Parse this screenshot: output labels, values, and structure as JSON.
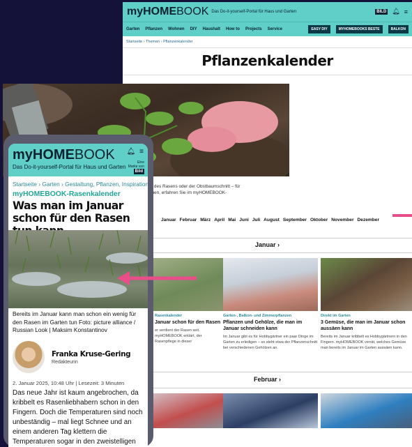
{
  "desktop": {
    "logo_bold": "myHOME",
    "logo_light": "BOOK",
    "tagline": "Das Do-it-yourself-Portal für Haus und Garten",
    "nav": [
      "Garten",
      "Pflanzen",
      "Wohnen",
      "DIY",
      "Haushalt",
      "How to",
      "Projects",
      "Service"
    ],
    "nav_buttons": [
      "EASY DIY",
      "MYHOMEBOOKS BESTE",
      "BALKON"
    ],
    "breadcrumb": "Startseite › Themen › Pflanzenkalender",
    "title": "Pflanzenkalender",
    "intro_line1": "gibt es etwas im Garten zu tun! Sei es die Anzucht von Pflanzen, die Pflege des Rasens oder der Obstbaumschnitt – für",
    "intro_line2": "er wird es nicht langweilig. Welche To-dos in den jeweiligen Monaten anstehen, erfahren Sie im myHOMEBOOK-",
    "intro_line3": "nder!",
    "months": [
      "Januar",
      "Februar",
      "März",
      "April",
      "Mai",
      "Juni",
      "Juli",
      "August",
      "September",
      "Oktober",
      "November",
      "Dezember"
    ],
    "section_januar": "Januar ›",
    "section_februar": "Februar ›",
    "cards": [
      {
        "category": "Rasenkalender",
        "title": "Januar schon für den Rasen",
        "text": "er verdient der Rasen seit. myHOMEBOOK erklärt, der Rasenpflege in dieser"
      },
      {
        "category": "Garten-, Balkon- und Zimmerpflanzen",
        "title": "Pflanzen und Gehölze, die man im Januar schneiden kann",
        "text": "Im Januar gibt es für Hobbygärtner ein paar Dinge im Garten zu erledigen – so steht etwa der Pflanzenschnitt bei verschiedenen Gehölzen an."
      },
      {
        "category": "Direkt im Garten",
        "title": "3 Gemüse, die man im Januar schon aussäen kann",
        "text": "Bereits im Januar kribbelt es Hobbygärtnern in den Fingern. myHOMEBOOK verrät, welches Gemüse man bereits im Januar im Garten aussäen kann."
      }
    ]
  },
  "mobile": {
    "logo_bold": "myHOME",
    "logo_light": "BOOK",
    "tagline": "Das Do-it-yourself-Portal für Haus und Garten",
    "bild_line1": "Eine",
    "bild_line2": "Marke von",
    "bild": "Bild",
    "breadcrumb": "Startseite › Garten › Gestaltung, Pflanzen, Inspiration",
    "kicker": "myHOMEBOOK-Rasenkalender",
    "headline": "Was man im Januar schon für den Rasen tun kann",
    "caption": "Bereits im Januar kann man schon ein wenig für den Rasen im Garten tun Foto: picture alliance / Russian Look | Maksim Konstantinov",
    "author_name": "Franka Kruse-Gering",
    "author_role": "Redakteurin",
    "date": "2. Januar 2025, 10:48 Uhr | Lesezeit: 3 Minuten",
    "body": "Das neue Jahr ist kaum angebrochen, da kribbelt es Rasenliebhabern schon in den Fingern. Doch die Temperaturen sind noch unbeständig – mal liegt Schnee und an einem anderen Tag klettern die Temperaturen sogar in den zweistelligen"
  },
  "colors": {
    "brand": "#5fcfc7",
    "background": "#141238",
    "accent_pink": "#e84f8a",
    "kicker": "#21a597"
  }
}
